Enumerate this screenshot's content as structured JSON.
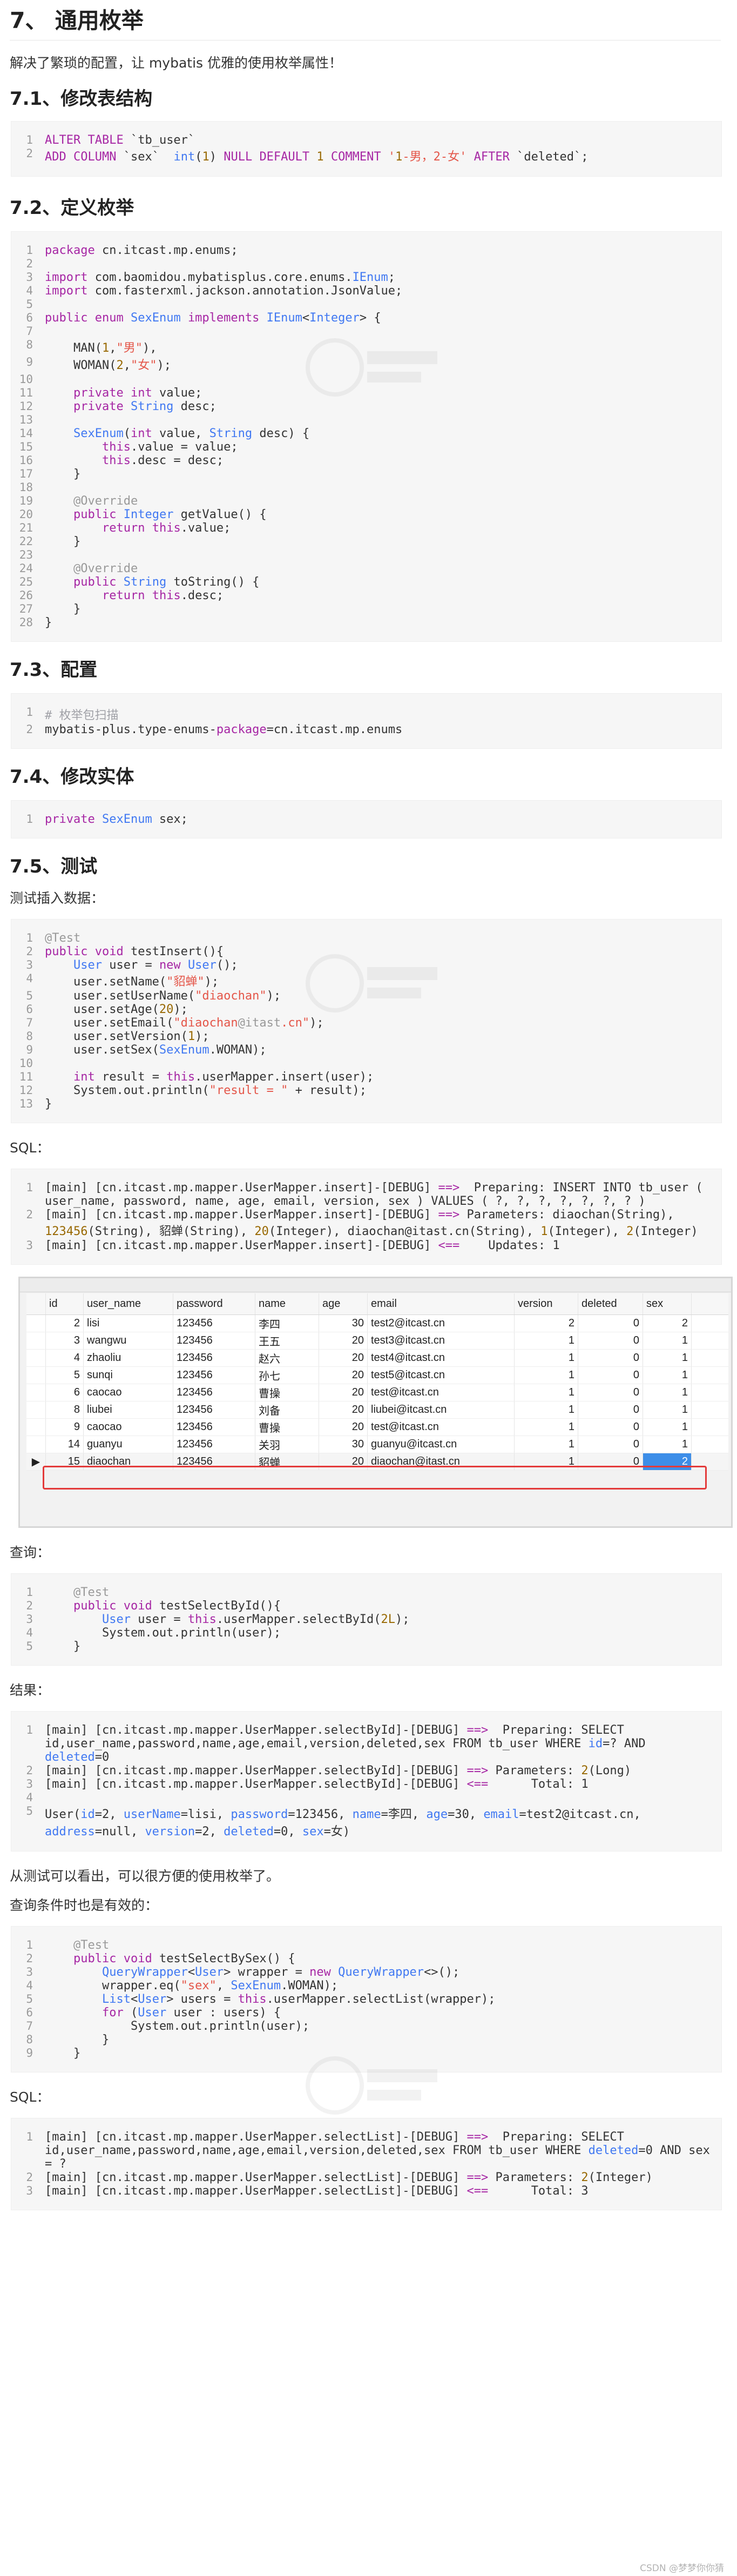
{
  "heading": "7、 通用枚举",
  "intro": "解决了繁琐的配置，让 mybatis 优雅的使用枚举属性！",
  "sections": {
    "s1": "7.1、修改表结构",
    "s2": "7.2、定义枚举",
    "s3": "7.3、配置",
    "s4": "7.4、修改实体",
    "s5": "7.5、测试"
  },
  "labels": {
    "insert_data": "测试插入数据：",
    "sql1": "SQL：",
    "query": "查询：",
    "result": "结果：",
    "note": "从测试可以看出，可以很方便的使用枚举了。",
    "query_cond": "查询条件时也是有效的：",
    "sql2": "SQL："
  },
  "table": {
    "columns": [
      "id",
      "user_name",
      "password",
      "name",
      "age",
      "email",
      "version",
      "deleted",
      "sex"
    ],
    "rows": [
      {
        "id": "2",
        "user_name": "lisi",
        "password": "123456",
        "name": "李四",
        "age": "30",
        "email": "test2@itcast.cn",
        "version": "2",
        "deleted": "0",
        "sex": "2"
      },
      {
        "id": "3",
        "user_name": "wangwu",
        "password": "123456",
        "name": "王五",
        "age": "20",
        "email": "test3@itcast.cn",
        "version": "1",
        "deleted": "0",
        "sex": "1"
      },
      {
        "id": "4",
        "user_name": "zhaoliu",
        "password": "123456",
        "name": "赵六",
        "age": "20",
        "email": "test4@itcast.cn",
        "version": "1",
        "deleted": "0",
        "sex": "1"
      },
      {
        "id": "5",
        "user_name": "sunqi",
        "password": "123456",
        "name": "孙七",
        "age": "20",
        "email": "test5@itcast.cn",
        "version": "1",
        "deleted": "0",
        "sex": "1"
      },
      {
        "id": "6",
        "user_name": "caocao",
        "password": "123456",
        "name": "曹操",
        "age": "20",
        "email": "test@itcast.cn",
        "version": "1",
        "deleted": "0",
        "sex": "1"
      },
      {
        "id": "8",
        "user_name": "liubei",
        "password": "123456",
        "name": "刘备",
        "age": "20",
        "email": "liubei@itcast.cn",
        "version": "1",
        "deleted": "0",
        "sex": "1"
      },
      {
        "id": "9",
        "user_name": "caocao",
        "password": "123456",
        "name": "曹操",
        "age": "20",
        "email": "test@itcast.cn",
        "version": "1",
        "deleted": "0",
        "sex": "1"
      },
      {
        "id": "14",
        "user_name": "guanyu",
        "password": "123456",
        "name": "关羽",
        "age": "30",
        "email": "guanyu@itcast.cn",
        "version": "1",
        "deleted": "0",
        "sex": "1"
      },
      {
        "id": "15",
        "user_name": "diaochan",
        "password": "123456",
        "name": "貂蝉",
        "age": "20",
        "email": "diaochan@itast.cn",
        "version": "1",
        "deleted": "0",
        "sex": "2"
      }
    ],
    "selected_marker": "▶"
  },
  "code": {
    "alter": [
      "ALTER TABLE `tb_user`",
      "ADD COLUMN `sex`  int(1) NULL DEFAULT 1 COMMENT '1-男，2-女' AFTER `deleted`;"
    ],
    "enum": [
      "package cn.itcast.mp.enums;",
      "",
      "import com.baomidou.mybatisplus.core.enums.IEnum;",
      "import com.fasterxml.jackson.annotation.JsonValue;",
      "",
      "public enum SexEnum implements IEnum<Integer> {",
      "",
      "    MAN(1,\"男\"),",
      "    WOMAN(2,\"女\");",
      "",
      "    private int value;",
      "    private String desc;",
      "",
      "    SexEnum(int value, String desc) {",
      "        this.value = value;",
      "        this.desc = desc;",
      "    }",
      "",
      "    @Override",
      "    public Integer getValue() {",
      "        return this.value;",
      "    }",
      "",
      "    @Override",
      "    public String toString() {",
      "        return this.desc;",
      "    }",
      "}"
    ],
    "config": [
      "# 枚举包扫描",
      "mybatis-plus.type-enums-package=cn.itcast.mp.enums"
    ],
    "entity": [
      "private SexEnum sex;"
    ],
    "insert": [
      "@Test",
      "public void testInsert(){",
      "    User user = new User();",
      "    user.setName(\"貂蝉\");",
      "    user.setUserName(\"diaochan\");",
      "    user.setAge(20);",
      "    user.setEmail(\"diaochan@itast.cn\");",
      "    user.setVersion(1);",
      "    user.setSex(SexEnum.WOMAN);",
      "",
      "    int result = this.userMapper.insert(user);",
      "    System.out.println(\"result = \" + result);",
      "}"
    ],
    "sql_insert": [
      "[main] [cn.itcast.mp.mapper.UserMapper.insert]-[DEBUG] ==>  Preparing: INSERT INTO tb_user ( user_name, password, name, age, email, version, sex ) VALUES ( ?, ?, ?, ?, ?, ?, ? )",
      "[main] [cn.itcast.mp.mapper.UserMapper.insert]-[DEBUG] ==> Parameters: diaochan(String), 123456(String), 貂蝉(String), 20(Integer), diaochan@itast.cn(String), 1(Integer), 2(Integer)",
      "[main] [cn.itcast.mp.mapper.UserMapper.insert]-[DEBUG] <==    Updates: 1"
    ],
    "select_by_id": [
      "    @Test",
      "    public void testSelectById(){",
      "        User user = this.userMapper.selectById(2L);",
      "        System.out.println(user);",
      "    }"
    ],
    "result_log": [
      "[main] [cn.itcast.mp.mapper.UserMapper.selectById]-[DEBUG] ==>  Preparing: SELECT id,user_name,password,name,age,email,version,deleted,sex FROM tb_user WHERE id=? AND deleted=0",
      "[main] [cn.itcast.mp.mapper.UserMapper.selectById]-[DEBUG] ==> Parameters: 2(Long)",
      "[main] [cn.itcast.mp.mapper.UserMapper.selectById]-[DEBUG] <==      Total: 1",
      "",
      "User(id=2, userName=lisi, password=123456, name=李四, age=30, email=test2@itcast.cn, address=null, version=2, deleted=0, sex=女)"
    ],
    "select_by_sex": [
      "    @Test",
      "    public void testSelectBySex() {",
      "        QueryWrapper<User> wrapper = new QueryWrapper<>();",
      "        wrapper.eq(\"sex\", SexEnum.WOMAN);",
      "        List<User> users = this.userMapper.selectList(wrapper);",
      "        for (User user : users) {",
      "            System.out.println(user);",
      "        }",
      "    }"
    ],
    "sql_list": [
      "[main] [cn.itcast.mp.mapper.UserMapper.selectList]-[DEBUG] ==>  Preparing: SELECT id,user_name,password,name,age,email,version,deleted,sex FROM tb_user WHERE deleted=0 AND sex = ?",
      "[main] [cn.itcast.mp.mapper.UserMapper.selectList]-[DEBUG] ==> Parameters: 2(Integer)",
      "[main] [cn.itcast.mp.mapper.UserMapper.selectList]-[DEBUG] <==      Total: 3"
    ]
  },
  "footer": "CSDN @梦梦你你猜",
  "colors": {
    "keyword": "#a626a4",
    "type": "#4078f2",
    "string": "#e45649",
    "number": "#986801",
    "comment": "#a0a1a7",
    "highlight": "#3d8ee8",
    "red_box": "#e33a3a"
  }
}
